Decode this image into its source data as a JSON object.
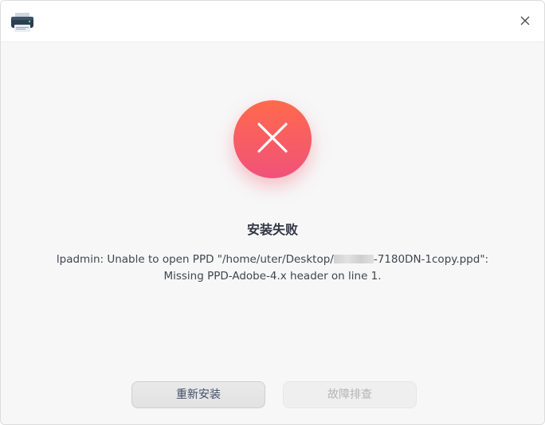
{
  "window": {
    "app_icon": "printer-icon",
    "close_icon": "close-icon"
  },
  "status": {
    "icon": "error-x-icon",
    "title": "安装失败",
    "message_part1": "lpadmin: Unable to open PPD \"/home/uter/Desktop/",
    "message_part2": "-7180DN-1copy.ppd\":",
    "message_line2": "Missing PPD-Adobe-4.x header on line 1."
  },
  "buttons": {
    "reinstall_label": "重新安装",
    "troubleshoot_label": "故障排查"
  },
  "colors": {
    "error_gradient_top": "#ff6a4c",
    "error_gradient_bottom": "#f0527a",
    "disabled_text": "#b4b4b4"
  }
}
